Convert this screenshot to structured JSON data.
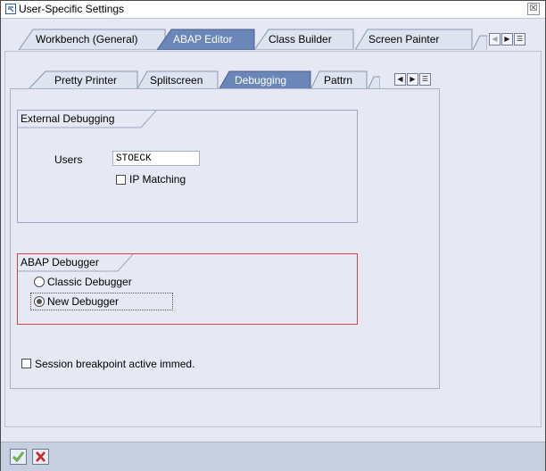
{
  "window": {
    "title": "User-Specific Settings",
    "close_glyph": "☒"
  },
  "outer_tabs": [
    {
      "label": "Workbench (General)",
      "active": false
    },
    {
      "label": "ABAP Editor",
      "active": true
    },
    {
      "label": "Class Builder",
      "active": false
    },
    {
      "label": "Screen Painter",
      "active": false
    }
  ],
  "inner_tabs": [
    {
      "label": "Pretty Printer",
      "active": false
    },
    {
      "label": "Splitscreen",
      "active": false
    },
    {
      "label": "Debugging",
      "active": true
    },
    {
      "label": "Pattrn",
      "active": false
    }
  ],
  "external_debugging": {
    "title": "External Debugging",
    "users_label": "Users",
    "users_value": "STOECK",
    "ip_matching_label": "IP Matching",
    "ip_matching_checked": false
  },
  "abap_debugger": {
    "title": "ABAP Debugger",
    "classic_label": "Classic Debugger",
    "new_label": "New Debugger",
    "selected": "new"
  },
  "session_breakpoint": {
    "label": "Session breakpoint active immed.",
    "checked": false
  },
  "footer": {
    "ok_icon": "green-check-icon",
    "cancel_icon": "red-x-icon"
  },
  "colors": {
    "active_tab": "#6b86b8",
    "inactive_tab": "#dde3ef",
    "accent_red": "#d54348",
    "panel_bg": "#e6e9f3"
  }
}
